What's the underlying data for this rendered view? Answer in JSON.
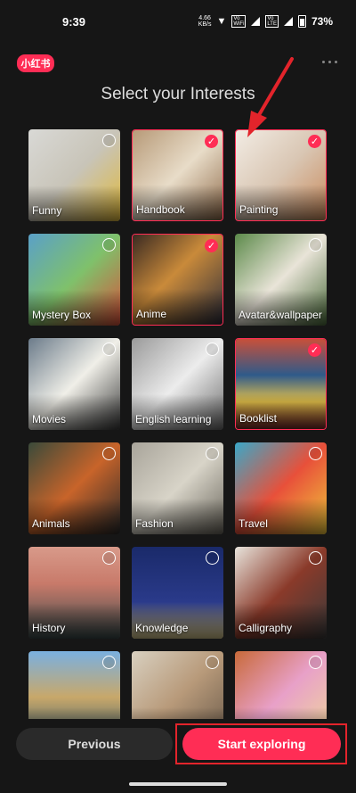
{
  "status": {
    "time": "9:39",
    "speed": "4.66\nKB/s",
    "net1": "Vo\nWiFi",
    "net2": "Vo\nLTE",
    "battery": "73%"
  },
  "app": {
    "logo": "小红书",
    "title": "Select your Interests"
  },
  "accent": "#ff2d55",
  "interests": [
    {
      "label": "Funny",
      "selected": false,
      "bg": "linear-gradient(135deg,#d9d9d6 0%,#c8c4b8 50%,#e0b93a 100%)"
    },
    {
      "label": "Handbook",
      "selected": true,
      "bg": "linear-gradient(135deg,#b79a78 0%,#e8dcc8 50%,#8f6b4a 100%)"
    },
    {
      "label": "Painting",
      "selected": true,
      "bg": "linear-gradient(135deg,#f2ece4 0%,#d9c6b3 50%,#c98a5b 100%)"
    },
    {
      "label": "Mystery Box",
      "selected": false,
      "bg": "linear-gradient(135deg,#5aa0c8 0%,#7fc16b 50%,#d8503a 100%)"
    },
    {
      "label": "Anime",
      "selected": true,
      "bg": "linear-gradient(135deg,#3a2a22 0%,#c98a3a 45%,#2d2d3a 100%)"
    },
    {
      "label": "Avatar&wallpaper",
      "selected": false,
      "bg": "linear-gradient(135deg,#5c8a4a 0%,#e9e4d8 50%,#4a6a3a 100%)"
    },
    {
      "label": "Movies",
      "selected": false,
      "bg": "linear-gradient(135deg,#6b7b8a 0%,#f0efe8 50%,#3a3a3a 100%)"
    },
    {
      "label": "English learning",
      "selected": false,
      "bg": "linear-gradient(135deg,#9a9a9a 0%,#ececec 50%,#6a6a6a 100%)"
    },
    {
      "label": "Booklist",
      "selected": true,
      "bg": "linear-gradient(180deg,#c8503a 0%,#2f5a8a 40%,#e5c24a 70%,#7a2a2a 100%)"
    },
    {
      "label": "Animals",
      "selected": false,
      "bg": "linear-gradient(135deg,#3a4a3a 0%,#c8642a 50%,#2a2a2a 100%)"
    },
    {
      "label": "Fashion",
      "selected": false,
      "bg": "linear-gradient(135deg,#a8a49a 0%,#d8d4c8 50%,#6a665c 100%)"
    },
    {
      "label": "Travel",
      "selected": false,
      "bg": "linear-gradient(135deg,#3aa8c8 0%,#e8503a 50%,#f0c83a 100%)"
    },
    {
      "label": "History",
      "selected": false,
      "bg": "linear-gradient(180deg,#d89a8a 0%,#c87a6a 40%,#3a4a4a 100%)"
    },
    {
      "label": "Knowledge",
      "selected": false,
      "bg": "linear-gradient(180deg,#1a2a6a 0%,#2a3a8a 60%,#d8c88a 100%)"
    },
    {
      "label": "Calligraphy",
      "selected": false,
      "bg": "linear-gradient(135deg,#e8e4dc 0%,#8a3a2a 50%,#3a3a3a 100%)"
    },
    {
      "label": "",
      "selected": false,
      "bg": "linear-gradient(180deg,#7ab0e0 0%,#c8a86a 50%,#3a5a6a 100%)"
    },
    {
      "label": "",
      "selected": false,
      "bg": "linear-gradient(135deg,#d8d0c0 0%,#b89a7a 50%,#6a5a4a 100%)"
    },
    {
      "label": "",
      "selected": false,
      "bg": "linear-gradient(135deg,#c86a3a 0%,#e8a0c8 50%,#f0d89a 100%)"
    }
  ],
  "buttons": {
    "previous": "Previous",
    "start": "Start exploring"
  }
}
